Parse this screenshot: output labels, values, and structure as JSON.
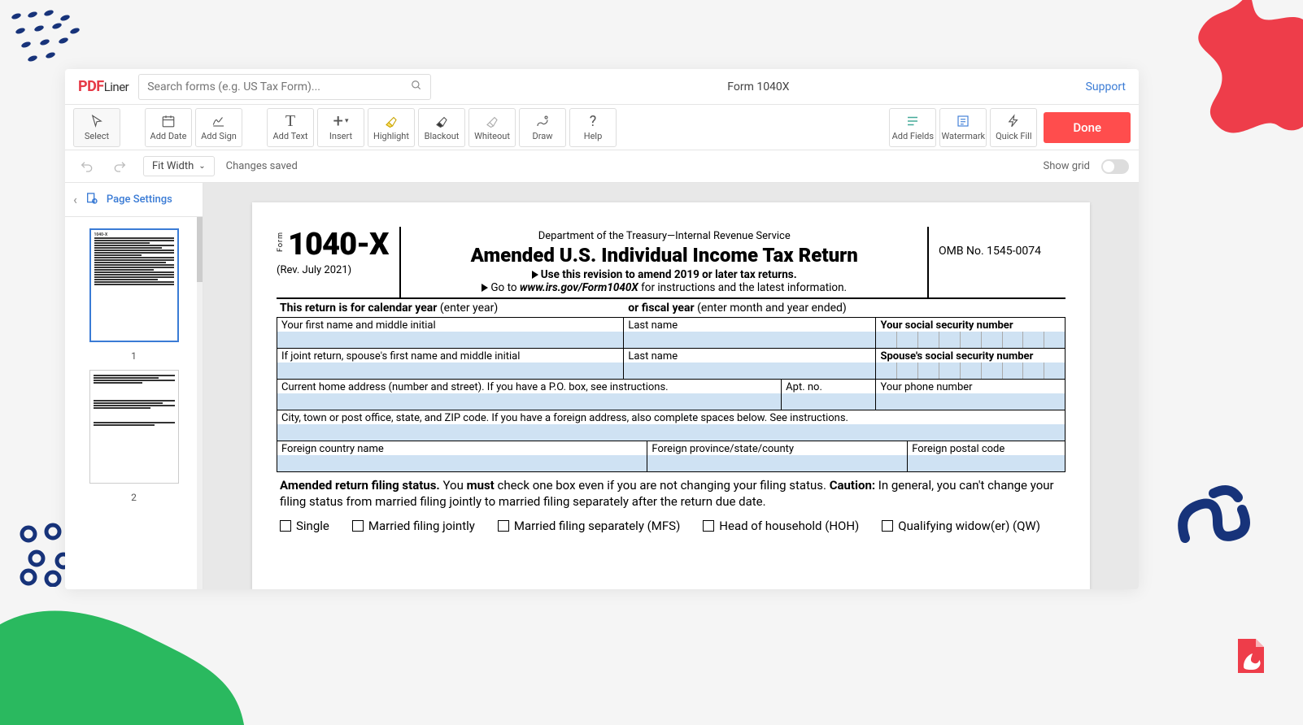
{
  "brand": {
    "p1": "PDF",
    "p2": "Liner"
  },
  "search": {
    "placeholder": "Search forms (e.g. US Tax Form)..."
  },
  "docTitle": "Form 1040X",
  "supportLabel": "Support",
  "tools": {
    "select": "Select",
    "addDate": "Add Date",
    "addSign": "Add Sign",
    "addText": "Add Text",
    "insert": "Insert",
    "highlight": "Highlight",
    "blackout": "Blackout",
    "whiteout": "Whiteout",
    "draw": "Draw",
    "help": "Help",
    "addFields": "Add Fields",
    "watermark": "Watermark",
    "quickFill": "Quick Fill",
    "done": "Done"
  },
  "subbar": {
    "zoom": "Fit Width",
    "saved": "Changes saved",
    "showGrid": "Show grid"
  },
  "sidebar": {
    "pageSettings": "Page Settings",
    "p1": "1",
    "p2": "2"
  },
  "form": {
    "wordForm": "Form",
    "number": "1040-X",
    "rev": "(Rev. July 2021)",
    "dept": "Department of the Treasury—Internal Revenue Service",
    "title": "Amended U.S. Individual Income Tax Return",
    "sub1": "Use this revision to amend 2019 or later tax returns.",
    "sub2a": "Go to ",
    "sub2b": "www.irs.gov/Form1040X",
    "sub2c": " for instructions and the latest information.",
    "omb": "OMB No. 1545-0074",
    "yearRow1": "This return is for calendar year",
    "yearRow2": "(enter year)",
    "yearRow3": "or fiscal year",
    "yearRow4": "(enter month and year ended)",
    "r1c1": "Your first name and middle initial",
    "r1c2": "Last name",
    "r1c3": "Your social security number",
    "r2c1": "If joint return, spouse's first name and middle initial",
    "r2c2": "Last name",
    "r2c3": "Spouse's social security number",
    "r3c1": "Current home address (number and street). If you have a P.O. box, see instructions.",
    "r3c2": "Apt. no.",
    "r3c3": "Your phone number",
    "r4c1": "City, town or post office, state, and ZIP code. If you have a foreign address, also complete spaces below. See instructions.",
    "r5c1": "Foreign country name",
    "r5c2": "Foreign province/state/county",
    "r5c3": "Foreign postal code",
    "amend1": "Amended return filing status.",
    "amend2": " You ",
    "amend3": "must",
    "amend4": " check one box even if you are not changing your filing status. ",
    "amend5": "Caution:",
    "amend6": " In general, you can't change your filing status from married filing jointly to married filing separately after the return due date.",
    "chk": {
      "single": "Single",
      "mfj": "Married filing jointly",
      "mfs": "Married filing separately (MFS)",
      "hoh": "Head of household (HOH)",
      "qw": "Qualifying widow(er) (QW)"
    }
  }
}
